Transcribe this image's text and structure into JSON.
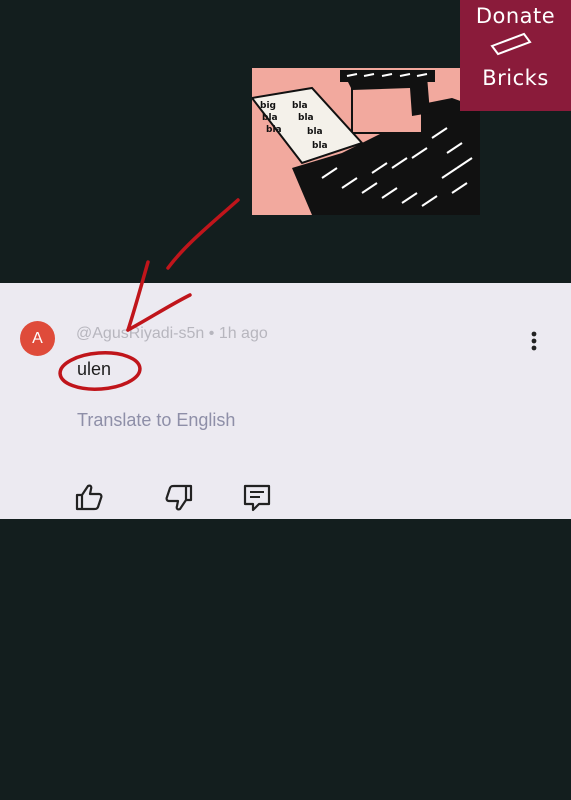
{
  "comment": {
    "avatar_letter": "A",
    "handle": "@AgusRiyadi-s5n",
    "separator": "•",
    "time": "1h ago",
    "text": "ulen",
    "translate_label": "Translate to English"
  },
  "donate": {
    "line1": "Donate",
    "line2": "Bricks"
  },
  "actions": {
    "like_icon": "thumbs-up-icon",
    "dislike_icon": "thumbs-down-icon",
    "reply_icon": "comment-icon",
    "more_icon": "more-vertical-icon"
  },
  "colors": {
    "background": "#131e1e",
    "card": "#eceaf1",
    "avatar": "#df4b3a",
    "annotation": "#c0151b",
    "donate_bg": "#8a1b3a",
    "illustration_bg": "#f2a99e"
  }
}
